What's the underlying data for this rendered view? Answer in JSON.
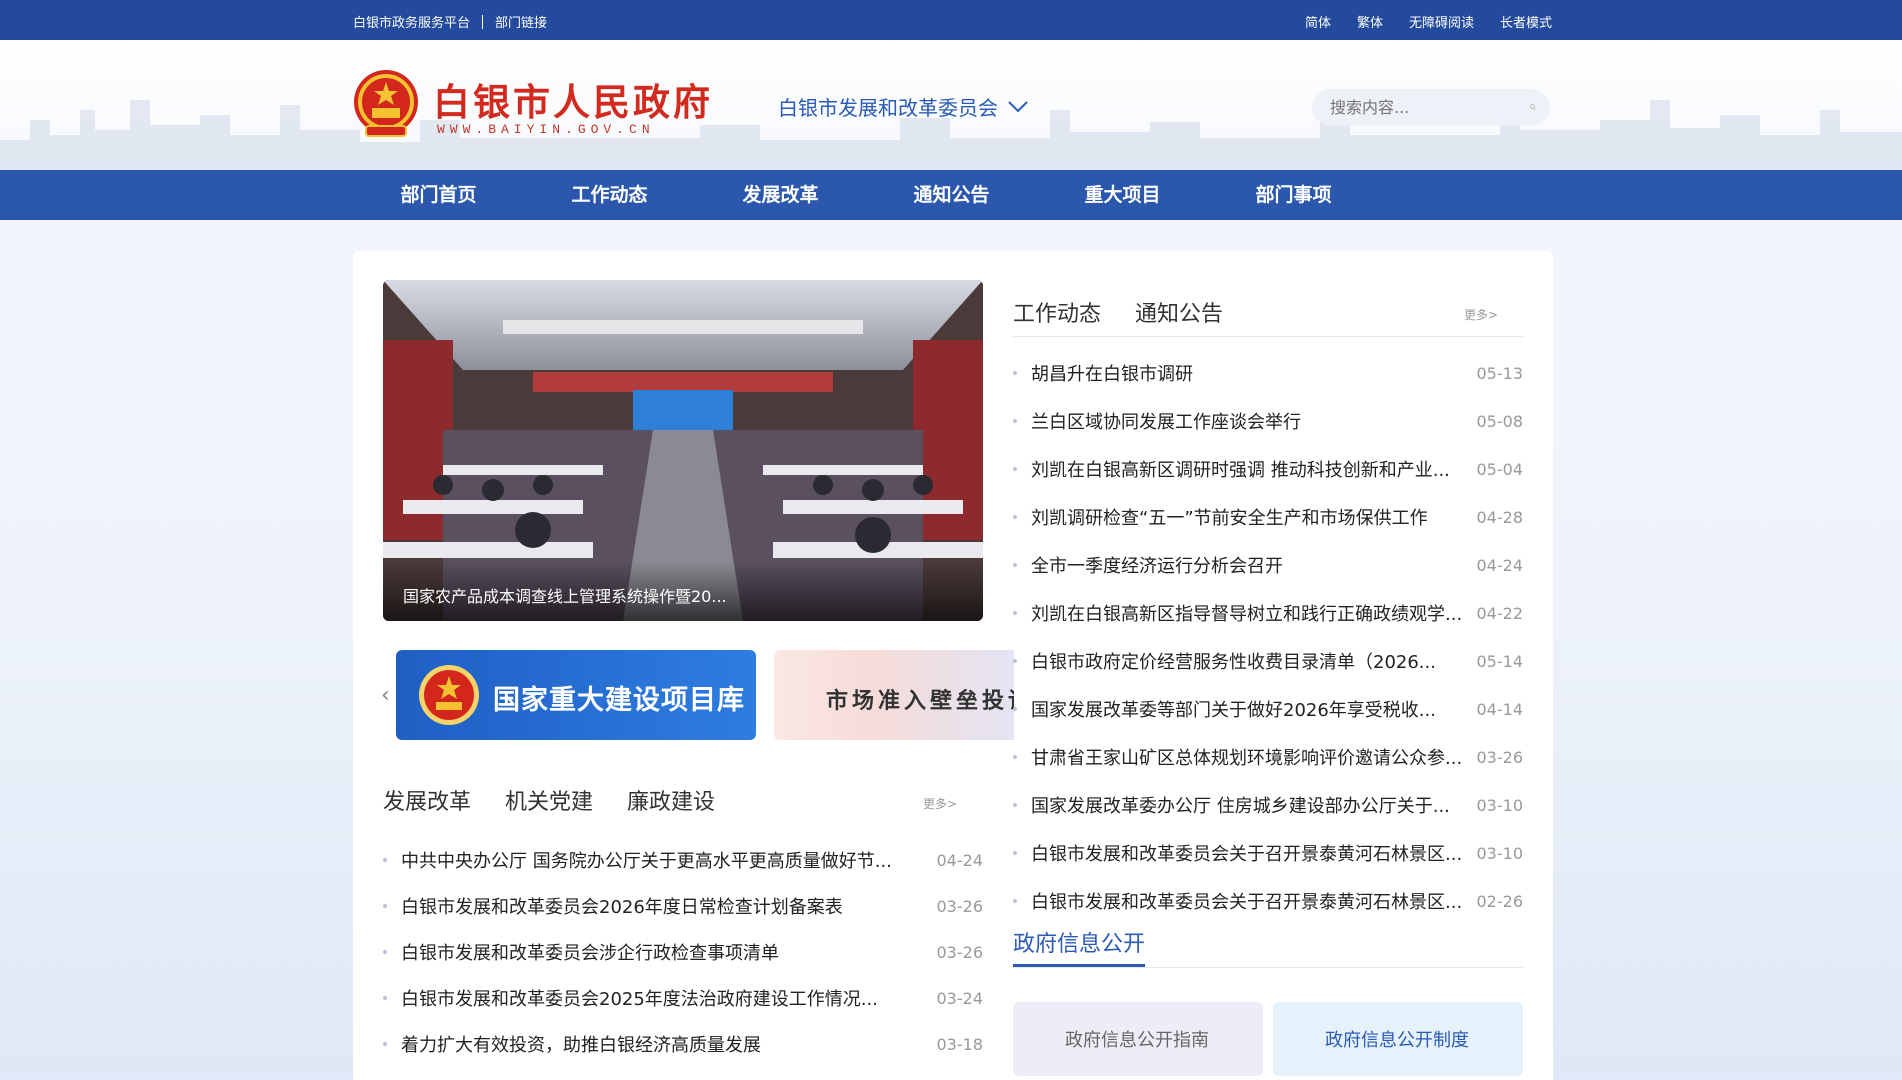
{
  "topbar": {
    "left_links": [
      "白银市政务服务平台",
      "部门链接"
    ],
    "right_links": [
      "简体",
      "繁体",
      "无障碍阅读",
      "长者模式"
    ]
  },
  "header": {
    "site_title": "白银市人民政府",
    "site_url": "WWW.BAIYIN.GOV.CN",
    "department": "白银市发展和改革委员会",
    "search_placeholder": "搜索内容..."
  },
  "nav": {
    "items": [
      "部门首页",
      "工作动态",
      "发展改革",
      "通知公告",
      "重大项目",
      "部门事项"
    ]
  },
  "carousel": {
    "caption": "国家农产品成本调查线上管理系统操作暨20..."
  },
  "banners": {
    "banner1": "国家重大建设项目库",
    "banner2": "市场准入壁垒投诉"
  },
  "right_news": {
    "tabs": [
      "工作动态",
      "通知公告"
    ],
    "more": "更多>",
    "items": [
      {
        "title": "胡昌升在白银市调研",
        "date": "05-13"
      },
      {
        "title": "兰白区域协同发展工作座谈会举行",
        "date": "05-08"
      },
      {
        "title": "刘凯在白银高新区调研时强调 推动科技创新和产业...",
        "date": "05-04"
      },
      {
        "title": "刘凯调研检查“五一”节前安全生产和市场保供工作",
        "date": "04-28"
      },
      {
        "title": "全市一季度经济运行分析会召开",
        "date": "04-24"
      },
      {
        "title": "刘凯在白银高新区指导督导树立和践行正确政绩观学...",
        "date": "04-22"
      },
      {
        "title": "白银市政府定价经营服务性收费目录清单（2026...",
        "date": "05-14"
      },
      {
        "title": "国家发展改革委等部门关于做好2026年享受税收...",
        "date": "04-14"
      },
      {
        "title": "甘肃省王家山矿区总体规划环境影响评价邀请公众参...",
        "date": "03-26"
      },
      {
        "title": "国家发展改革委办公厅 住房城乡建设部办公厅关于...",
        "date": "03-10"
      },
      {
        "title": "白银市发展和改革委员会关于召开景泰黄河石林景区...",
        "date": "03-10"
      },
      {
        "title": "白银市发展和改革委员会关于召开景泰黄河石林景区...",
        "date": "02-26"
      }
    ]
  },
  "left_news": {
    "tabs": [
      "发展改革",
      "机关党建",
      "廉政建设"
    ],
    "more": "更多>",
    "items": [
      {
        "title": "中共中央办公厅 国务院办公厅关于更高水平更高质量做好节...",
        "date": "04-24"
      },
      {
        "title": "白银市发展和改革委员会2026年度日常检查计划备案表",
        "date": "03-26"
      },
      {
        "title": "白银市发展和改革委员会涉企行政检查事项清单",
        "date": "03-26"
      },
      {
        "title": "白银市发展和改革委员会2025年度法治政府建设工作情况...",
        "date": "03-24"
      },
      {
        "title": "着力扩大有效投资，助推白银经济高质量发展",
        "date": "03-18"
      }
    ]
  },
  "gov_info": {
    "title": "政府信息公开",
    "cards": [
      "政府信息公开指南",
      "政府信息公开制度"
    ]
  },
  "colors": {
    "primary_blue": "#234a9c",
    "nav_blue": "#2b58ad",
    "brand_red": "#d22a1e"
  }
}
